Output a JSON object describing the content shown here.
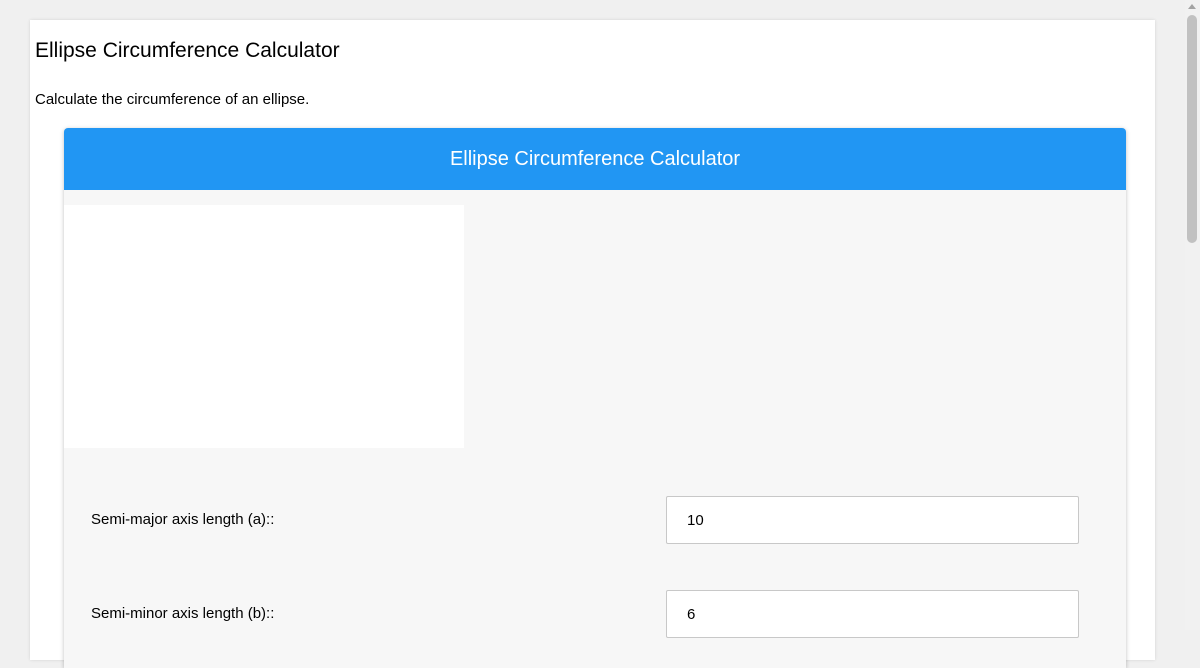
{
  "page": {
    "title": "Ellipse Circumference Calculator",
    "description": "Calculate the circumference of an ellipse."
  },
  "calculator": {
    "header": "Ellipse Circumference Calculator",
    "fields": [
      {
        "label": "Semi-major axis length (a)::",
        "value": "10"
      },
      {
        "label": "Semi-minor axis length (b)::",
        "value": "6"
      }
    ]
  },
  "colors": {
    "header_background": "#2196f3",
    "card_background": "#f7f7f7"
  }
}
